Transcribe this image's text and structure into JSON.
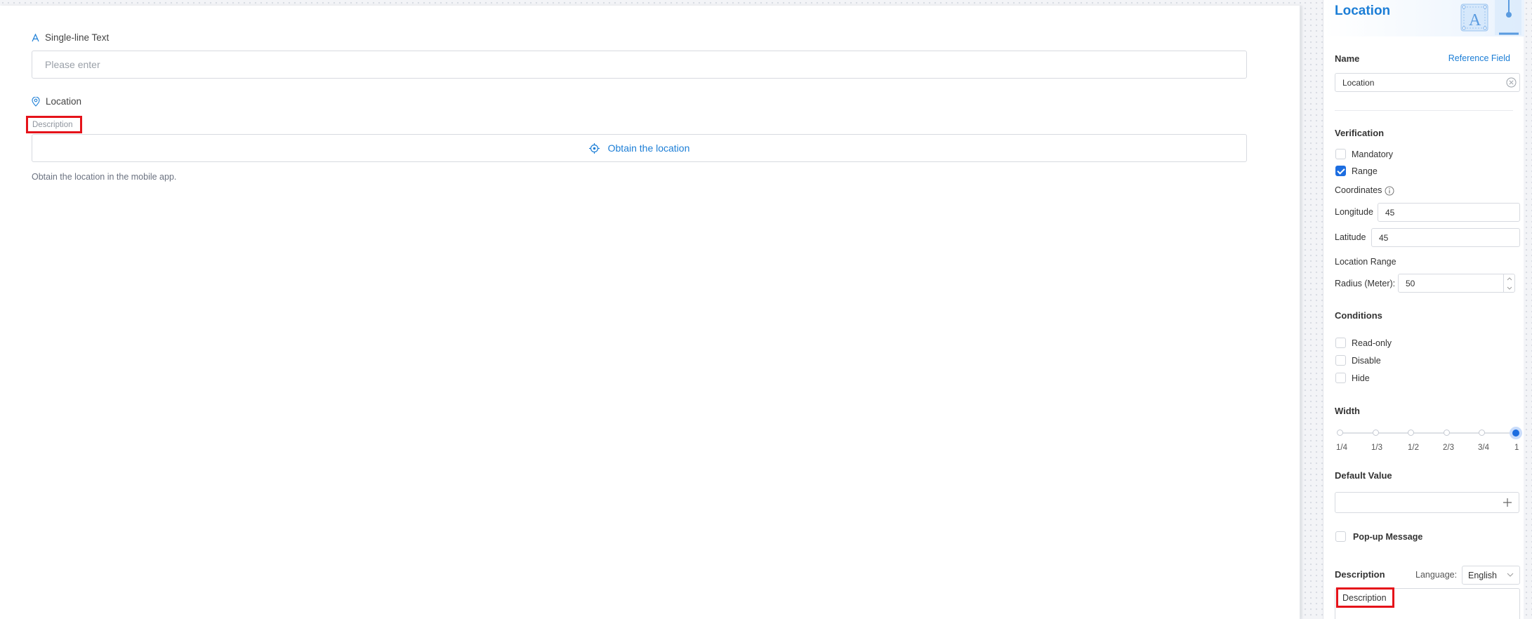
{
  "canvas": {
    "single_line": {
      "label": "Single-line Text",
      "placeholder": "Please enter"
    },
    "location": {
      "label": "Location",
      "description": "Description",
      "button_label": "Obtain the location",
      "help_text": "Obtain the location in the mobile app."
    }
  },
  "panel": {
    "title": "Location",
    "name_label": "Name",
    "reference_link": "Reference Field",
    "name_value": "Location",
    "verification": {
      "title": "Verification",
      "mandatory": {
        "label": "Mandatory",
        "checked": false
      },
      "range": {
        "label": "Range",
        "checked": true
      },
      "coordinates_label": "Coordinates",
      "longitude_label": "Longitude",
      "longitude_value": "45",
      "latitude_label": "Latitude",
      "latitude_value": "45",
      "location_range_label": "Location Range",
      "radius_label": "Radius (Meter):",
      "radius_value": "50"
    },
    "conditions": {
      "title": "Conditions",
      "read_only": "Read-only",
      "disable": "Disable",
      "hide": "Hide"
    },
    "width": {
      "title": "Width",
      "options": [
        "1/4",
        "1/3",
        "1/2",
        "2/3",
        "3/4",
        "1"
      ],
      "selected": "1"
    },
    "default_value": {
      "title": "Default Value",
      "value": ""
    },
    "popup_message": "Pop-up Message",
    "description": {
      "title": "Description",
      "language_label": "Language:",
      "language_value": "English",
      "value": "Description"
    }
  },
  "colors": {
    "accent": "#1c7ed6",
    "checkbox": "#1c6de0",
    "highlight": "#e5131a"
  }
}
